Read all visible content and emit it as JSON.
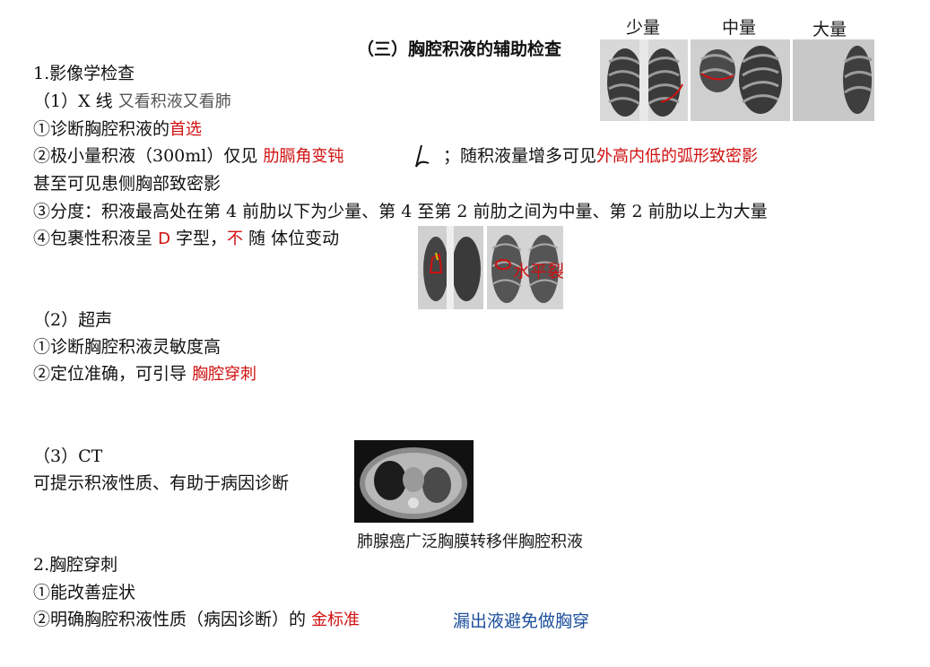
{
  "title": "（三）胸腔积液的辅助检查",
  "xray_labels": [
    "少量",
    "中量",
    "大量"
  ],
  "lines": {
    "l1": "1.影像学检查",
    "l2_a": "（1）X 线",
    "l2_b": "又看积液又看肺",
    "l3_a": "①诊断胸腔积液的",
    "l3_b": "首选",
    "l4_a": "②极小量积液（300ml）仅见",
    "l4_b": "肋膈角变钝",
    "l4_c": "；随积液量增多可见",
    "l4_d": "外高内低的弧形致密影",
    "l5": "甚至可见患侧胸部致密影",
    "l6": "③分度：积液最高处在第 4 前肋以下为少量、第 4 至第 2 前肋之间为中量、第 2 前肋以上为大量",
    "l7_a": "④包裹性积液呈",
    "l7_b": "D",
    "l7_c": "字型，",
    "l7_d": "不",
    "l7_e": "随 体位变动",
    "water_label": "水平裂",
    "l8": "（2）超声",
    "l9": "①诊断胸腔积液灵敏度高",
    "l10_a": "②定位准确，可引导",
    "l10_b": "胸腔穿刺",
    "l11": "（3）CT",
    "l12": "可提示积液性质、有助于病因诊断",
    "ct_caption": "肺腺癌广泛胸膜转移伴胸腔积液",
    "l13": "2.胸腔穿刺",
    "l14": "①能改善症状",
    "l15_a": "②明确胸腔积液性质（病因诊断）的",
    "l15_b": "金标准",
    "l15_c": "漏出液避免做胸穿"
  },
  "colors": {
    "red_annotation": "#d01010",
    "blue_annotation": "#1c4f9c"
  }
}
